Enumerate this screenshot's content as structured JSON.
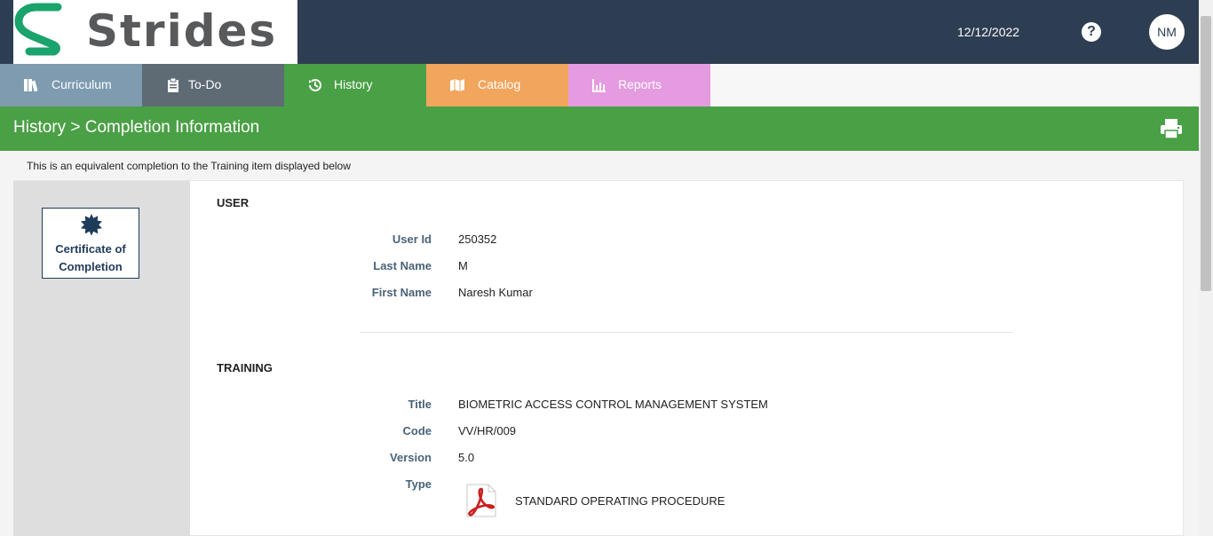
{
  "header": {
    "logo_text": "Strides",
    "date": "12/12/2022",
    "help_label": "?",
    "avatar_initials": "NM"
  },
  "nav": {
    "tabs": [
      {
        "label": "Curriculum",
        "color": "#7e9bb0",
        "icon": "books-icon"
      },
      {
        "label": "To-Do",
        "color": "#5e6b75",
        "icon": "clipboard-icon"
      },
      {
        "label": "History",
        "color": "#4aa045",
        "icon": "history-icon"
      },
      {
        "label": "Catalog",
        "color": "#f2a55c",
        "icon": "map-icon"
      },
      {
        "label": "Reports",
        "color": "#e59be0",
        "icon": "chart-icon"
      }
    ]
  },
  "page": {
    "breadcrumb": "History > Completion Information",
    "note": "This is an equivalent completion to the Training item displayed below"
  },
  "certificate": {
    "label_line1": "Certificate of",
    "label_line2": "Completion"
  },
  "user": {
    "heading": "USER",
    "user_id_label": "User Id",
    "user_id": "250352",
    "last_name_label": "Last Name",
    "last_name": "M",
    "first_name_label": "First Name",
    "first_name": "Naresh Kumar"
  },
  "training": {
    "heading": "TRAINING",
    "title_label": "Title",
    "title": "BIOMETRIC ACCESS CONTROL MANAGEMENT SYSTEM",
    "code_label": "Code",
    "code": "VV/HR/009",
    "version_label": "Version",
    "version": "5.0",
    "type_label": "Type",
    "type": "STANDARD OPERATING PROCEDURE"
  },
  "colors": {
    "header_bg": "#2e3e52",
    "green_bar": "#4aa045",
    "label_color": "#4a6378",
    "logo_green": "#1aa36b"
  }
}
